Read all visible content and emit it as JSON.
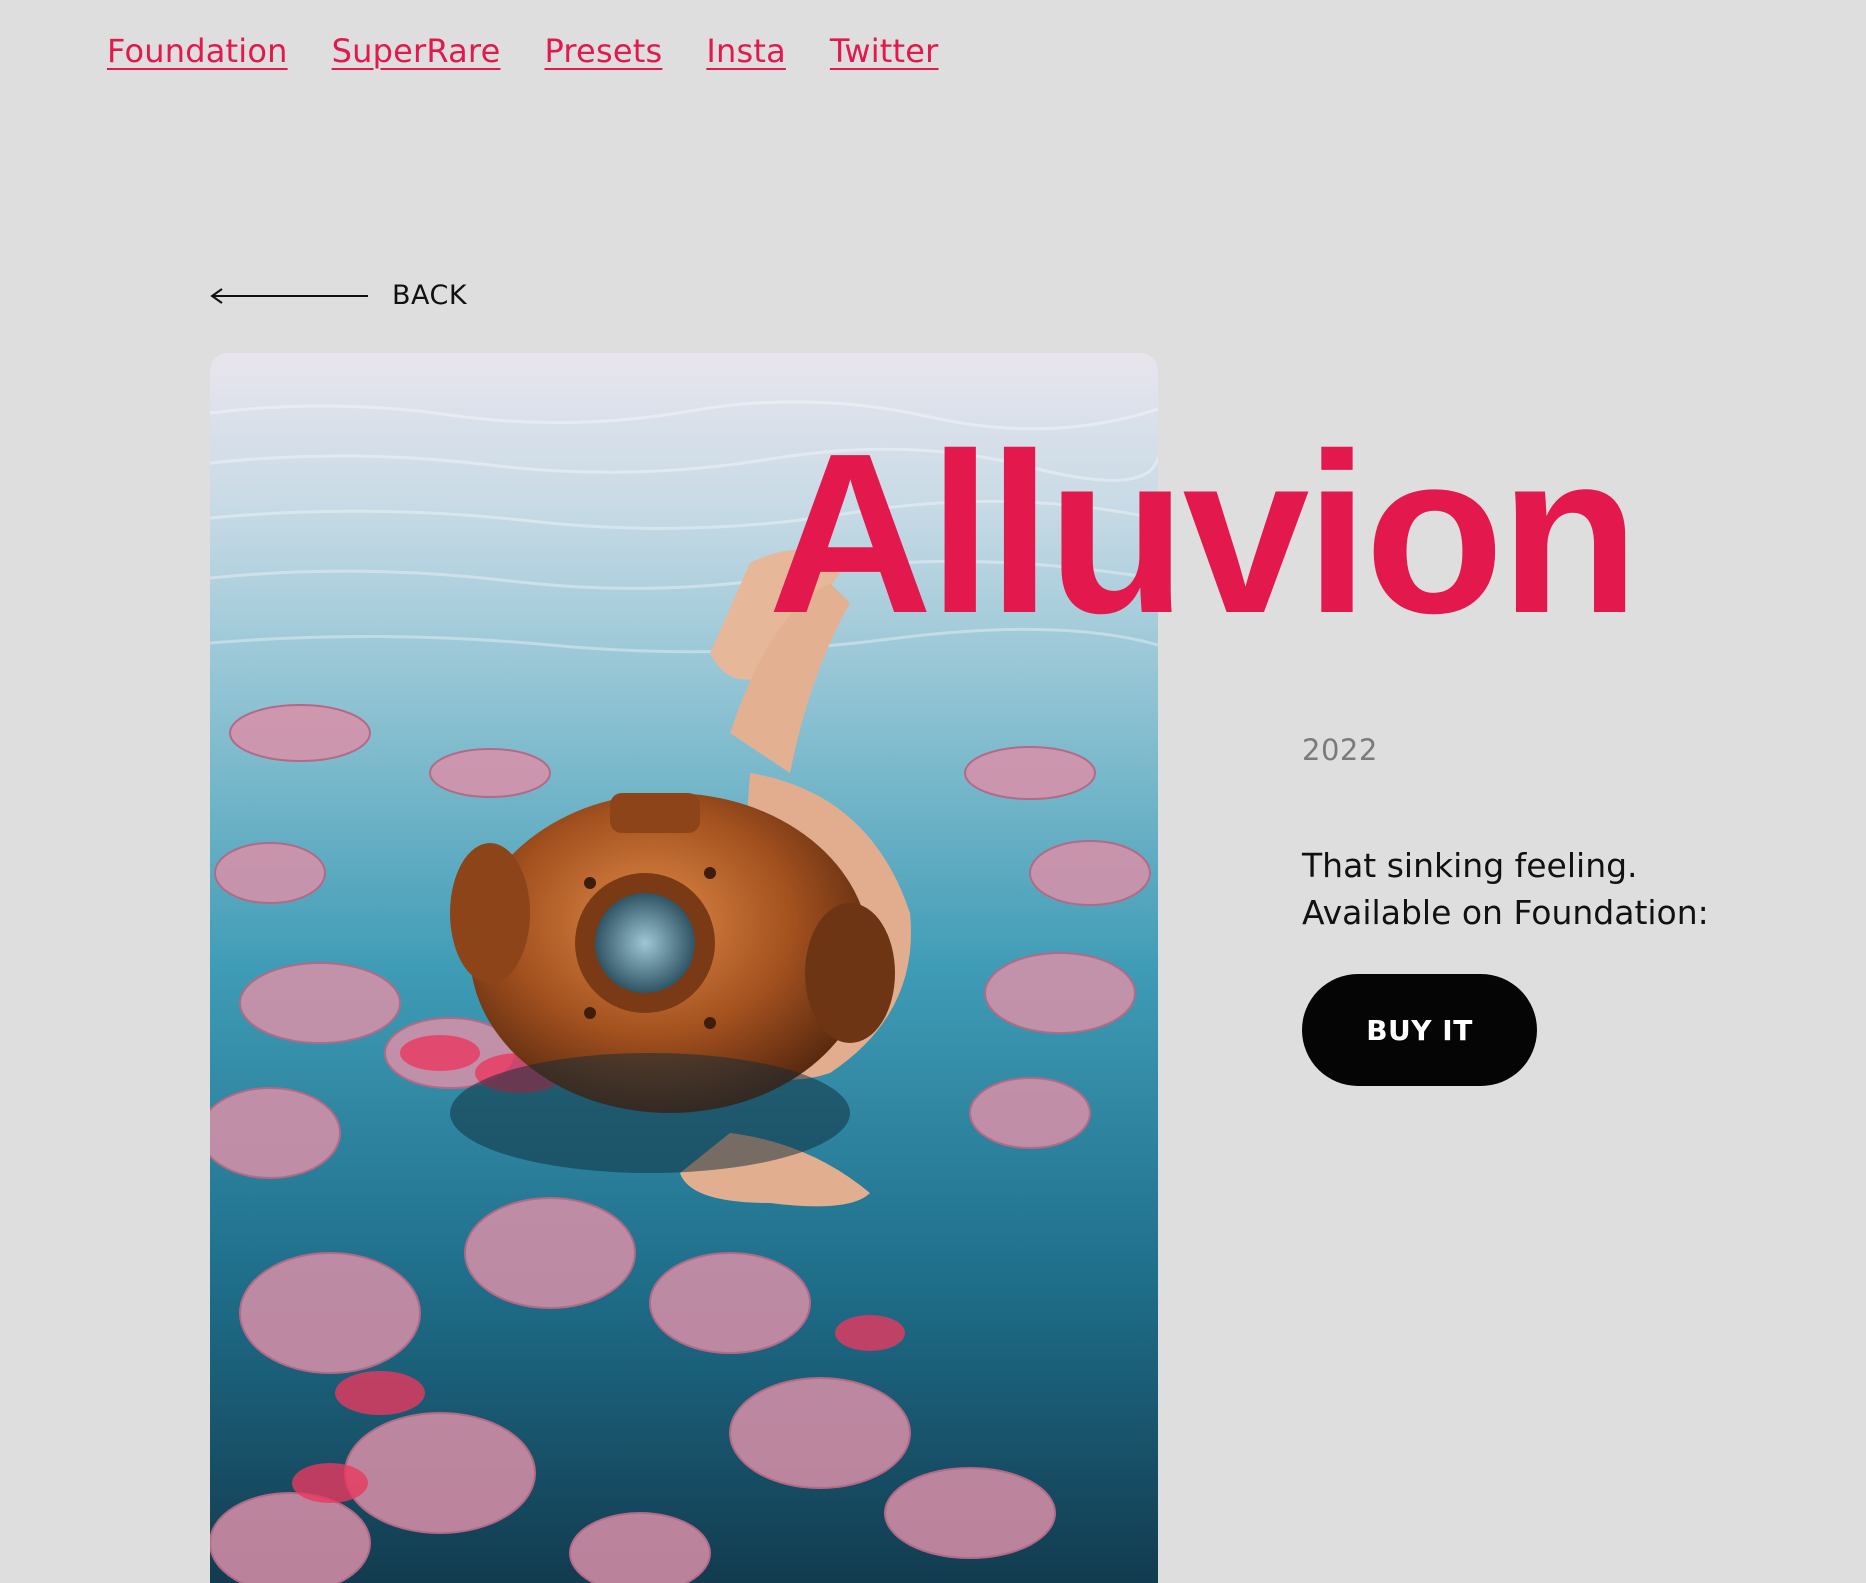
{
  "nav": {
    "links": [
      "Foundation",
      "SuperRare",
      "Presets",
      "Insta",
      "Twitter"
    ]
  },
  "back": {
    "label": "BACK",
    "icon": "arrow-left-icon"
  },
  "artwork": {
    "description_icon": "artwork-image"
  },
  "work": {
    "title": "Alluvion",
    "year": "2022",
    "description_line1": "That sinking feeling.",
    "description_line2": "Available on Foundation:",
    "buy_label": "BUY IT"
  },
  "colors": {
    "accent": "#e3184d",
    "background": "#dedede",
    "button": "#050505",
    "year": "#7b7b7b"
  }
}
